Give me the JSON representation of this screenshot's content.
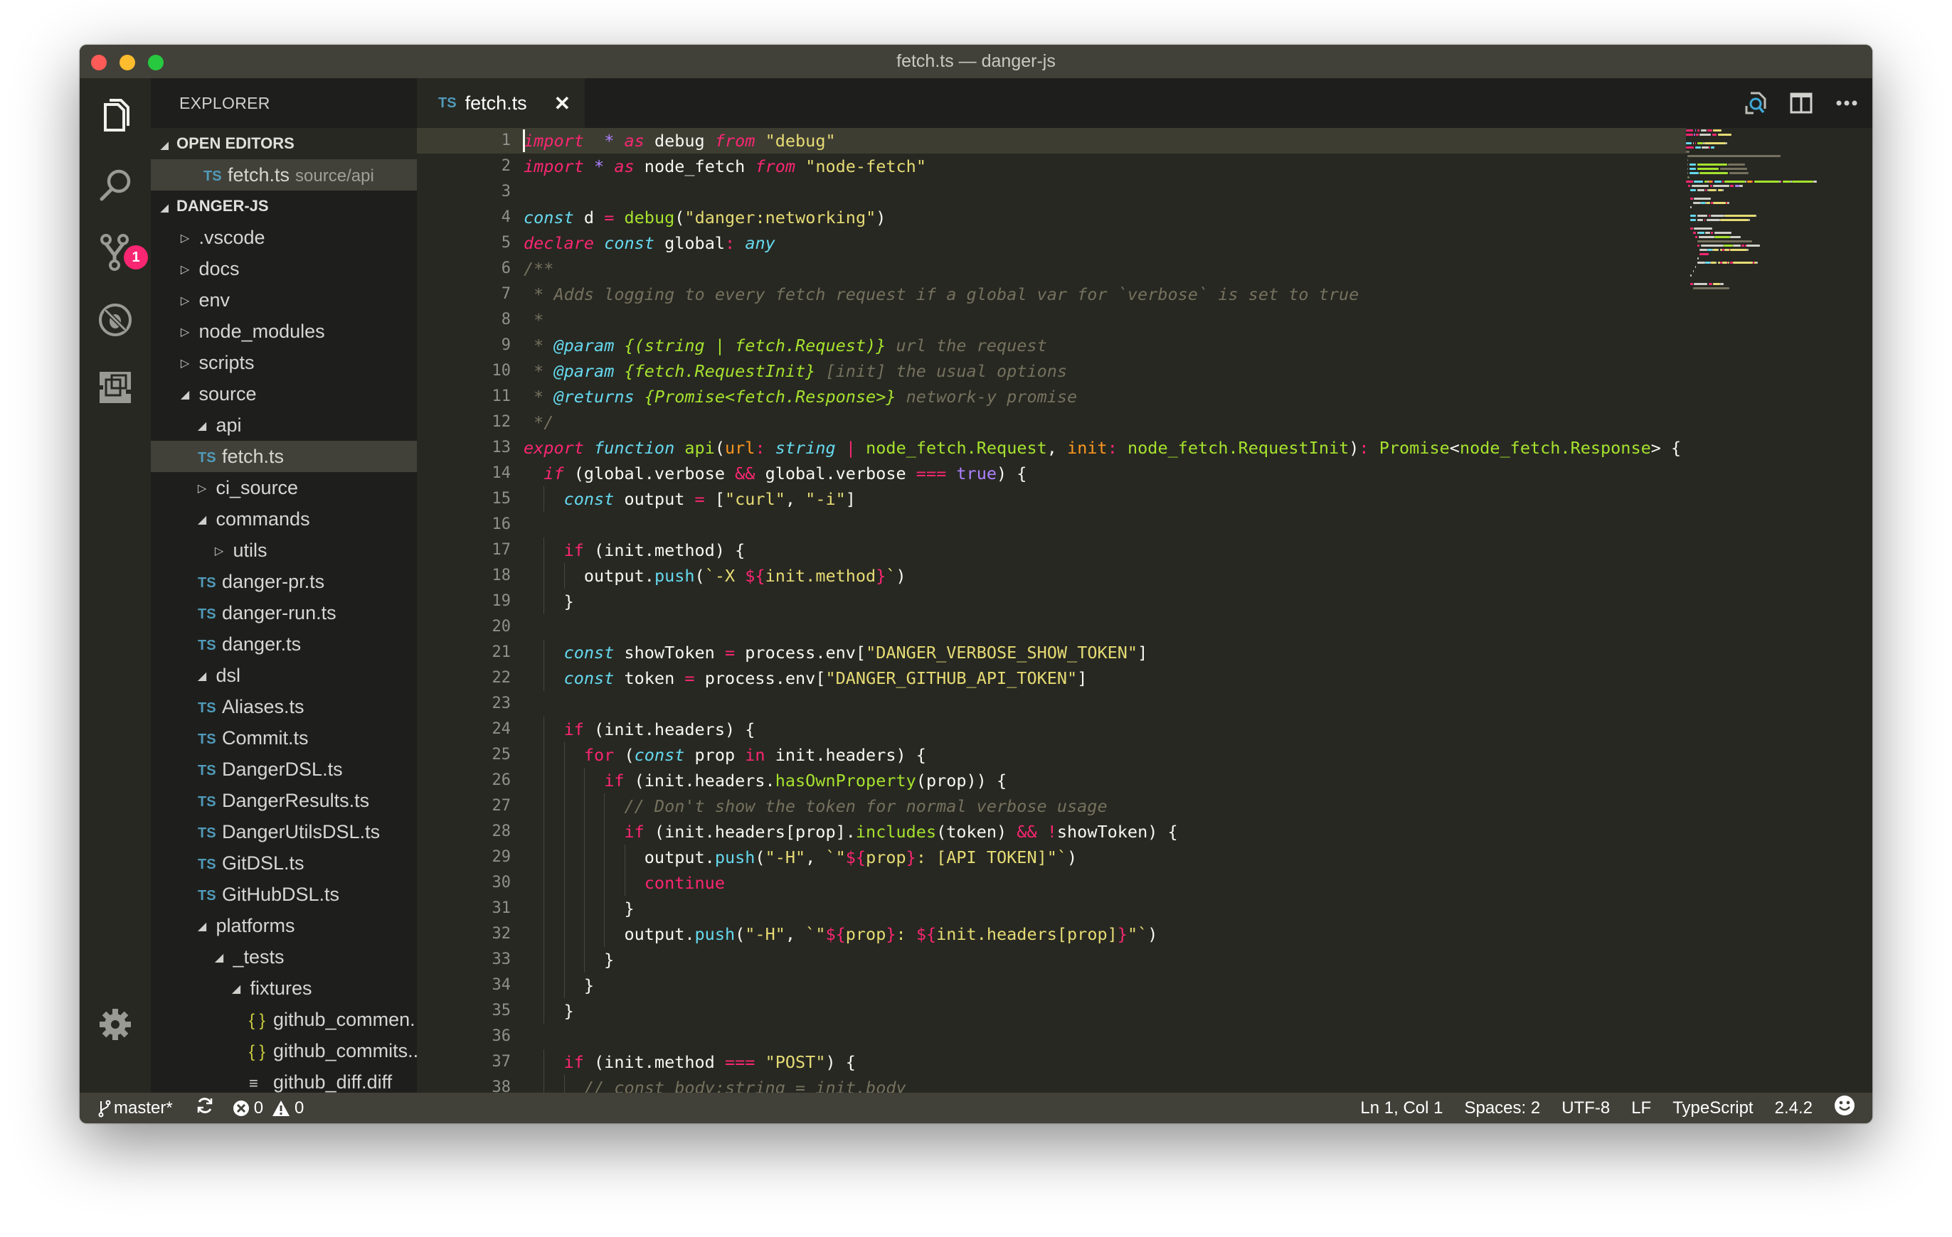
{
  "window": {
    "title": "fetch.ts — danger-js"
  },
  "activity_bar": {
    "items": [
      {
        "name": "explorer",
        "icon": "files-icon",
        "active": true
      },
      {
        "name": "search",
        "icon": "search-icon"
      },
      {
        "name": "source-control",
        "icon": "source-control-icon",
        "badge": "1"
      },
      {
        "name": "debug",
        "icon": "debug-icon"
      },
      {
        "name": "extensions",
        "icon": "extensions-icon"
      }
    ],
    "settings_icon": "gear-icon"
  },
  "sidebar": {
    "header": "EXPLORER",
    "open_editors": {
      "label": "OPEN EDITORS",
      "items": [
        {
          "icon": "TS",
          "name": "fetch.ts",
          "path": "source/api"
        }
      ]
    },
    "project": {
      "label": "DANGER-JS",
      "items": [
        {
          "depth": 0,
          "type": "folder",
          "expanded": false,
          "name": ".vscode"
        },
        {
          "depth": 0,
          "type": "folder",
          "expanded": false,
          "name": "docs"
        },
        {
          "depth": 0,
          "type": "folder",
          "expanded": false,
          "name": "env"
        },
        {
          "depth": 0,
          "type": "folder",
          "expanded": false,
          "name": "node_modules"
        },
        {
          "depth": 0,
          "type": "folder",
          "expanded": false,
          "name": "scripts"
        },
        {
          "depth": 0,
          "type": "folder",
          "expanded": true,
          "name": "source"
        },
        {
          "depth": 1,
          "type": "folder",
          "expanded": true,
          "name": "api"
        },
        {
          "depth": 1,
          "type": "ts",
          "icon": "TS",
          "name": "fetch.ts",
          "selected": true
        },
        {
          "depth": 1,
          "type": "folder",
          "expanded": false,
          "name": "ci_source"
        },
        {
          "depth": 1,
          "type": "folder",
          "expanded": true,
          "name": "commands"
        },
        {
          "depth": 2,
          "type": "folder",
          "expanded": false,
          "name": "utils"
        },
        {
          "depth": 1,
          "type": "ts",
          "icon": "TS",
          "name": "danger-pr.ts"
        },
        {
          "depth": 1,
          "type": "ts",
          "icon": "TS",
          "name": "danger-run.ts"
        },
        {
          "depth": 1,
          "type": "ts",
          "icon": "TS",
          "name": "danger.ts"
        },
        {
          "depth": 1,
          "type": "folder",
          "expanded": true,
          "name": "dsl"
        },
        {
          "depth": 1,
          "type": "ts",
          "icon": "TS",
          "name": "Aliases.ts"
        },
        {
          "depth": 1,
          "type": "ts",
          "icon": "TS",
          "name": "Commit.ts"
        },
        {
          "depth": 1,
          "type": "ts",
          "icon": "TS",
          "name": "DangerDSL.ts"
        },
        {
          "depth": 1,
          "type": "ts",
          "icon": "TS",
          "name": "DangerResults.ts"
        },
        {
          "depth": 1,
          "type": "ts",
          "icon": "TS",
          "name": "DangerUtilsDSL.ts"
        },
        {
          "depth": 1,
          "type": "ts",
          "icon": "TS",
          "name": "GitDSL.ts"
        },
        {
          "depth": 1,
          "type": "ts",
          "icon": "TS",
          "name": "GitHubDSL.ts"
        },
        {
          "depth": 1,
          "type": "folder",
          "expanded": true,
          "name": "platforms"
        },
        {
          "depth": 2,
          "type": "folder",
          "expanded": true,
          "name": "_tests"
        },
        {
          "depth": 3,
          "type": "folder",
          "expanded": true,
          "name": "fixtures"
        },
        {
          "depth": 3,
          "type": "json",
          "icon": "{ }",
          "name": "github_commen..."
        },
        {
          "depth": 3,
          "type": "json",
          "icon": "{ }",
          "name": "github_commits..."
        },
        {
          "depth": 3,
          "type": "diff",
          "icon": "≡",
          "name": "github_diff.diff"
        }
      ]
    }
  },
  "tabs": [
    {
      "icon": "TS",
      "label": "fetch.ts",
      "close": "✕",
      "active": true
    }
  ],
  "editor_actions": [
    "open-changes-icon",
    "split-editor-icon",
    "more-actions-icon"
  ],
  "editor": {
    "current_line": 1,
    "lines": [
      [
        [
          "kw",
          "import"
        ],
        [
          "",
          "  "
        ],
        [
          "opp",
          "*"
        ],
        [
          "",
          ""
        ],
        [
          "kw",
          " as"
        ],
        [
          "",
          " debug "
        ],
        [
          "kw",
          "from"
        ],
        [
          "",
          " "
        ],
        [
          "str",
          "\"debug\""
        ]
      ],
      [
        [
          "kw",
          "import"
        ],
        [
          "",
          " "
        ],
        [
          "opp",
          "*"
        ],
        [
          "kw",
          " as"
        ],
        [
          "",
          " node_fetch "
        ],
        [
          "kw",
          "from"
        ],
        [
          "",
          " "
        ],
        [
          "str",
          "\"node-fetch\""
        ]
      ],
      [],
      [
        [
          "st",
          "const"
        ],
        [
          "",
          " d "
        ],
        [
          "op",
          "="
        ],
        [
          "",
          " "
        ],
        [
          "fn",
          "debug"
        ],
        [
          "",
          "("
        ],
        [
          "str",
          "\"danger:networking\""
        ],
        [
          "",
          ")"
        ]
      ],
      [
        [
          "kw",
          "declare"
        ],
        [
          "",
          " "
        ],
        [
          "st",
          "const"
        ],
        [
          "",
          " global"
        ],
        [
          "op",
          ":"
        ],
        [
          "",
          " "
        ],
        [
          "st",
          "any"
        ]
      ],
      [
        [
          "cm",
          "/**"
        ]
      ],
      [
        [
          "cm",
          " * Adds logging to every fetch request if a global var for `verbose` is set to true"
        ]
      ],
      [
        [
          "cm",
          " *"
        ]
      ],
      [
        [
          "cm",
          " * "
        ],
        [
          "doc",
          "@param"
        ],
        [
          "cm",
          " "
        ],
        [
          "doct",
          "{(string | fetch.Request)}"
        ],
        [
          "cm",
          " url the request"
        ]
      ],
      [
        [
          "cm",
          " * "
        ],
        [
          "doc",
          "@param"
        ],
        [
          "cm",
          " "
        ],
        [
          "doct",
          "{fetch.RequestInit}"
        ],
        [
          "cm",
          " [init] the usual options"
        ]
      ],
      [
        [
          "cm",
          " * "
        ],
        [
          "doc",
          "@returns"
        ],
        [
          "cm",
          " "
        ],
        [
          "doct",
          "{Promise<fetch.Response>}"
        ],
        [
          "cm",
          " network-y promise"
        ]
      ],
      [
        [
          "cm",
          " */"
        ]
      ],
      [
        [
          "kw",
          "export"
        ],
        [
          "",
          " "
        ],
        [
          "st",
          "function"
        ],
        [
          "",
          " "
        ],
        [
          "fn",
          "api"
        ],
        [
          "",
          "("
        ],
        [
          "prm",
          "url"
        ],
        [
          "op",
          ":"
        ],
        [
          "",
          " "
        ],
        [
          "st",
          "string"
        ],
        [
          "",
          " "
        ],
        [
          "op",
          "|"
        ],
        [
          "",
          " "
        ],
        [
          "ty",
          "node_fetch.Request"
        ],
        [
          "",
          ", "
        ],
        [
          "prm",
          "init"
        ],
        [
          "op",
          ":"
        ],
        [
          "",
          " "
        ],
        [
          "ty",
          "node_fetch.RequestInit"
        ],
        [
          "",
          ")"
        ],
        [
          "op",
          ":"
        ],
        [
          "",
          " "
        ],
        [
          "ty",
          "Promise"
        ],
        [
          "",
          "<"
        ],
        [
          "ty",
          "node_fetch.Response"
        ],
        [
          "",
          "> {"
        ]
      ],
      [
        [
          "",
          ""
        ],
        [
          "kw",
          "  if"
        ],
        [
          "",
          " (global.verbose "
        ],
        [
          "op",
          "&&"
        ],
        [
          "",
          " global.verbose "
        ],
        [
          "op",
          "==="
        ],
        [
          "",
          " "
        ],
        [
          "num",
          "true"
        ],
        [
          "",
          ") {"
        ]
      ],
      [
        [
          "",
          "    "
        ],
        [
          "st",
          "const"
        ],
        [
          "",
          " output "
        ],
        [
          "op",
          "="
        ],
        [
          "",
          " ["
        ],
        [
          "str",
          "\"curl\""
        ],
        [
          "",
          ", "
        ],
        [
          "str",
          "\"-i\""
        ],
        [
          "",
          "]"
        ]
      ],
      [],
      [
        [
          "",
          "    "
        ],
        [
          "kwn",
          "if"
        ],
        [
          "",
          " (init.method) {"
        ]
      ],
      [
        [
          "",
          "      output."
        ],
        [
          "fnb",
          "push"
        ],
        [
          "",
          "("
        ],
        [
          "str",
          "`-X "
        ],
        [
          "op",
          "${"
        ],
        [
          "str",
          "init.method"
        ],
        [
          "op",
          "}"
        ],
        [
          "str",
          "`"
        ],
        [
          "",
          ")"
        ]
      ],
      [
        [
          "",
          "    }"
        ]
      ],
      [],
      [
        [
          "",
          "    "
        ],
        [
          "st",
          "const"
        ],
        [
          "",
          " showToken "
        ],
        [
          "op",
          "="
        ],
        [
          "",
          " process.env["
        ],
        [
          "str",
          "\"DANGER_VERBOSE_SHOW_TOKEN\""
        ],
        [
          "",
          "]"
        ]
      ],
      [
        [
          "",
          "    "
        ],
        [
          "st",
          "const"
        ],
        [
          "",
          " token "
        ],
        [
          "op",
          "="
        ],
        [
          "",
          " process.env["
        ],
        [
          "str",
          "\"DANGER_GITHUB_API_TOKEN\""
        ],
        [
          "",
          "]"
        ]
      ],
      [],
      [
        [
          "",
          "    "
        ],
        [
          "kwn",
          "if"
        ],
        [
          "",
          " (init.headers) {"
        ]
      ],
      [
        [
          "",
          "      "
        ],
        [
          "kwn",
          "for"
        ],
        [
          "",
          " ("
        ],
        [
          "st",
          "const"
        ],
        [
          "",
          " prop "
        ],
        [
          "kwn",
          "in"
        ],
        [
          "",
          " init.headers) {"
        ]
      ],
      [
        [
          "",
          "        "
        ],
        [
          "kwn",
          "if"
        ],
        [
          "",
          " (init.headers."
        ],
        [
          "fn",
          "hasOwnProperty"
        ],
        [
          "",
          "(prop)) {"
        ]
      ],
      [
        [
          "",
          "          "
        ],
        [
          "cm",
          "// Don't show the token for normal verbose usage"
        ]
      ],
      [
        [
          "",
          "          "
        ],
        [
          "kwn",
          "if"
        ],
        [
          "",
          " (init.headers[prop]."
        ],
        [
          "fn",
          "includes"
        ],
        [
          "",
          "(token) "
        ],
        [
          "op",
          "&&"
        ],
        [
          "",
          " "
        ],
        [
          "op",
          "!"
        ],
        [
          "",
          "showToken) {"
        ]
      ],
      [
        [
          "",
          "            output."
        ],
        [
          "fnb",
          "push"
        ],
        [
          "",
          "("
        ],
        [
          "str",
          "\"-H\""
        ],
        [
          "",
          ", "
        ],
        [
          "str",
          "`\""
        ],
        [
          "op",
          "${"
        ],
        [
          "str",
          "prop"
        ],
        [
          "op",
          "}"
        ],
        [
          "str",
          ": [API TOKEN]\"`"
        ],
        [
          "",
          ")"
        ]
      ],
      [
        [
          "",
          "            "
        ],
        [
          "kwn",
          "continue"
        ]
      ],
      [
        [
          "",
          "          }"
        ]
      ],
      [
        [
          "",
          "          output."
        ],
        [
          "fnb",
          "push"
        ],
        [
          "",
          "("
        ],
        [
          "str",
          "\"-H\""
        ],
        [
          "",
          ", "
        ],
        [
          "str",
          "`\""
        ],
        [
          "op",
          "${"
        ],
        [
          "str",
          "prop"
        ],
        [
          "op",
          "}"
        ],
        [
          "str",
          ": "
        ],
        [
          "op",
          "${"
        ],
        [
          "str",
          "init.headers[prop]"
        ],
        [
          "op",
          "}"
        ],
        [
          "str",
          "\"`"
        ],
        [
          "",
          ")"
        ]
      ],
      [
        [
          "",
          "        }"
        ]
      ],
      [
        [
          "",
          "      }"
        ]
      ],
      [
        [
          "",
          "    }"
        ]
      ],
      [],
      [
        [
          "",
          "    "
        ],
        [
          "kwn",
          "if"
        ],
        [
          "",
          " (init.method "
        ],
        [
          "op",
          "==="
        ],
        [
          "",
          " "
        ],
        [
          "str",
          "\"POST\""
        ],
        [
          "",
          ") {"
        ]
      ],
      [
        [
          "",
          "      "
        ],
        [
          "cm",
          "// const body:string = init.body"
        ]
      ]
    ]
  },
  "statusbar": {
    "branch": "master*",
    "errors": "0",
    "warnings": "0",
    "cursor": "Ln 1, Col 1",
    "indent": "Spaces: 2",
    "encoding": "UTF-8",
    "eol": "LF",
    "language": "TypeScript",
    "ts_version": "2.4.2"
  },
  "colors": {
    "editor_bg": "#272822",
    "sidebar_bg": "#1e1f1c",
    "titlebar_bg": "#414139",
    "statusbar_bg": "#414139",
    "badge": "#f92672",
    "ts_icon": "#519aba",
    "json_icon": "#cbcb41"
  }
}
